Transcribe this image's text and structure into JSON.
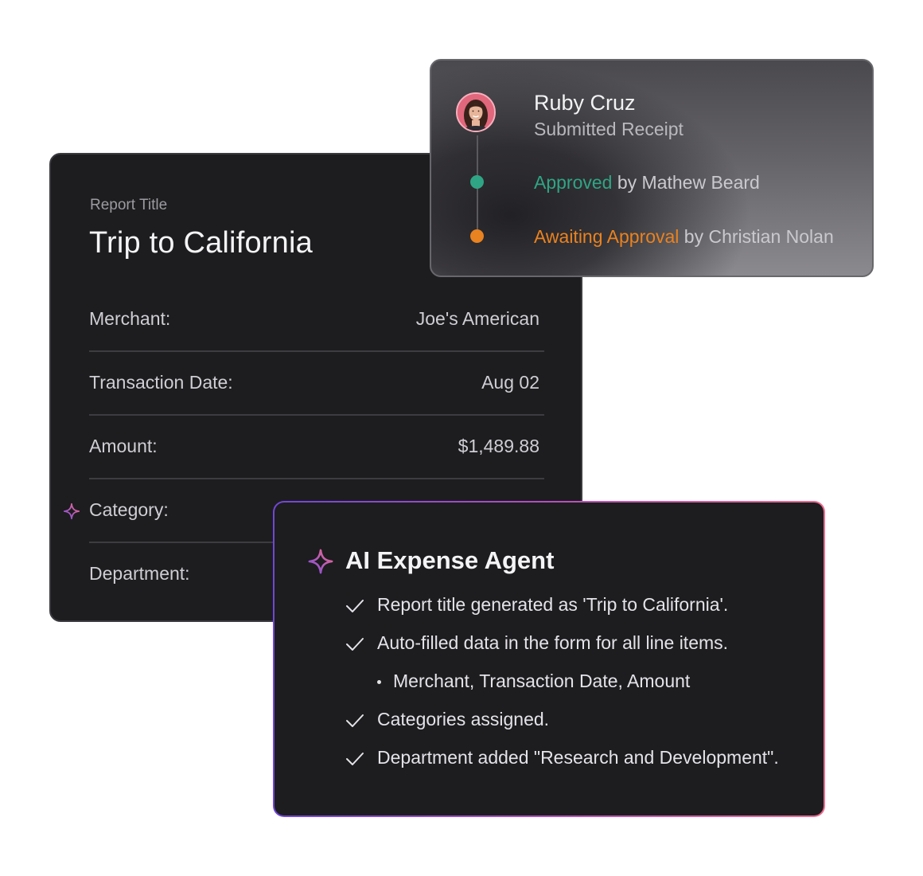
{
  "report": {
    "label": "Report Title",
    "title": "Trip to California",
    "fields": [
      {
        "label": "Merchant:",
        "value": "Joe's American"
      },
      {
        "label": "Transaction Date:",
        "value": "Aug 02"
      },
      {
        "label": "Amount:",
        "value": "$1,489.88"
      },
      {
        "label": "Category:",
        "value": ""
      },
      {
        "label": "Department:",
        "value": ""
      }
    ]
  },
  "approval": {
    "name": "Ruby Cruz",
    "subtitle": "Submitted Receipt",
    "steps": [
      {
        "status": "Approved",
        "by": " by Mathew Beard",
        "color": "#2fa585"
      },
      {
        "status": "Awaiting Approval",
        "by": " by Christian Nolan",
        "color": "#e98220"
      }
    ]
  },
  "agent": {
    "title": "AI Expense Agent",
    "items": [
      "Report title generated as 'Trip to California'.",
      "Auto-filled data in the form for all line items.",
      "Categories assigned.",
      "Department added \"Research and Development\"."
    ],
    "subitem": "Merchant, Transaction Date, Amount",
    "icons": {
      "agent": "sparkle-icon",
      "item": "check-icon"
    }
  },
  "colors": {
    "card_bg": "#1d1c1f",
    "approved": "#2fa585",
    "awaiting": "#e98220",
    "gradient_start": "#6f47d6",
    "gradient_end": "#ee6b8e"
  }
}
